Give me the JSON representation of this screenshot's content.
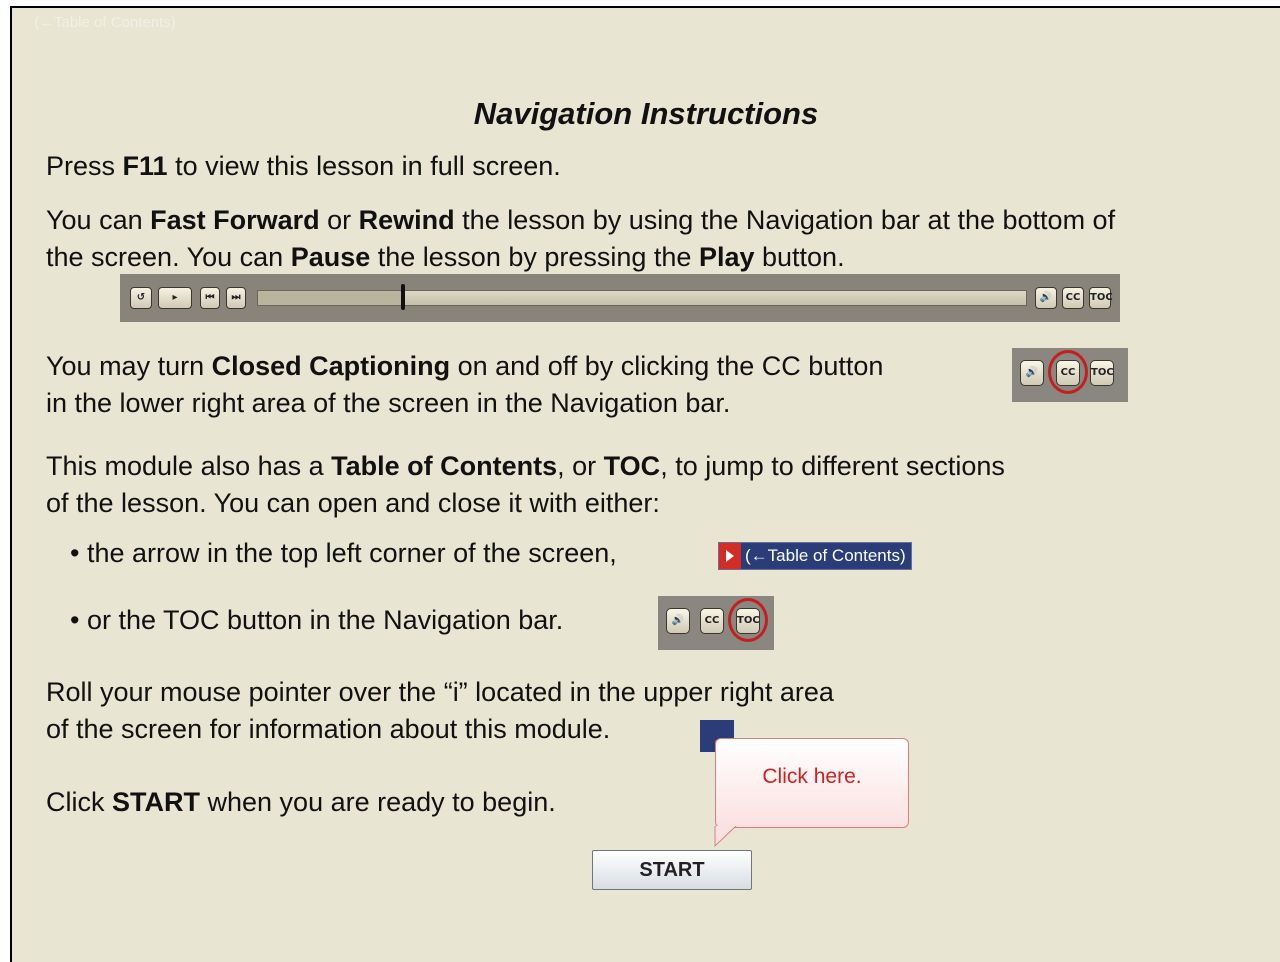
{
  "header": {
    "toc_link": "(←Table of Contents)"
  },
  "title": "Navigation Instructions",
  "p1": {
    "pre": "Press ",
    "key": "F11",
    "post": " to view this lesson in full screen."
  },
  "p2": {
    "t1": "You can ",
    "b1": "Fast Forward",
    "t2": " or ",
    "b2": "Rewind",
    "t3": " the lesson by using the Navigation bar at the bottom of",
    "t4": "the screen.  You can ",
    "b3": "Pause",
    "t5": " the lesson by pressing the ",
    "b4": "Play",
    "t6": " button."
  },
  "navbar": {
    "progress_fraction": 0.19,
    "buttons": {
      "replay": "↺",
      "play": "▸",
      "prev": "⏮",
      "next": "⏭",
      "audio": "🔊",
      "cc": "CC",
      "toc": "TOC"
    }
  },
  "p3": {
    "t1": "You may turn ",
    "b1": "Closed Captioning",
    "t2": " on and off by clicking the CC button",
    "t3": "in the lower right area of the screen in the Navigation bar."
  },
  "p4": {
    "t1": "This module also has a ",
    "b1": "Table of Contents",
    "t2": ", or ",
    "b2": "TOC",
    "t3": ", to jump to different sections",
    "t4": "of the lesson. You can open and close it with either:"
  },
  "bullets": [
    "the arrow in the top left corner of the screen,",
    "or the TOC button in the Navigation bar."
  ],
  "toc_sample": {
    "label": "(←Table of Contents)"
  },
  "p5": {
    "l1": "Roll your mouse pointer over the “i” located in the upper right area",
    "l2": "of the screen for information about this module."
  },
  "p6": {
    "t1": "Click ",
    "b1": "START",
    "t2": " when you are ready to begin."
  },
  "callout": {
    "text": "Click here."
  },
  "start_button": {
    "label": "START"
  },
  "colors": {
    "accent_red": "#c41f1f",
    "toc_blue": "#2a3d78",
    "background": "#e8e5d3"
  }
}
